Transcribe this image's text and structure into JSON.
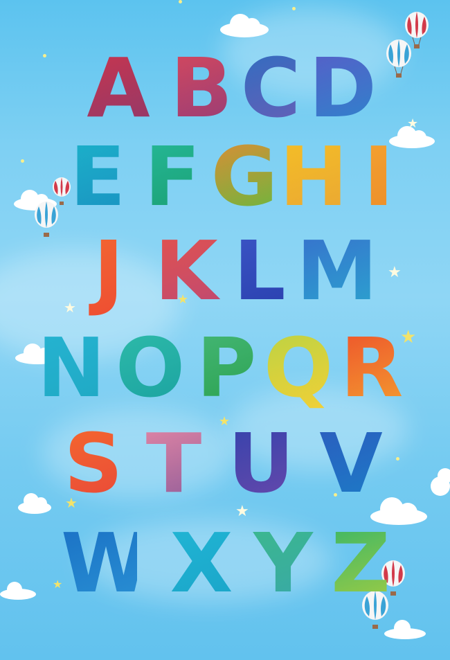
{
  "poster": {
    "background_color": "#7ed0f3",
    "decorations": [
      "cloud",
      "hot-air-balloon",
      "star"
    ]
  },
  "alphabet": [
    {
      "char": "A",
      "colors": [
        "#c8364c",
        "#8a3a6a"
      ]
    },
    {
      "char": "B",
      "colors": [
        "#d44a5c",
        "#8e3d78"
      ]
    },
    {
      "char": "C",
      "colors": [
        "#2f6fbd",
        "#6a5db2"
      ]
    },
    {
      "char": "D",
      "colors": [
        "#5a5cc2",
        "#2f86c9"
      ]
    },
    {
      "char": "E",
      "colors": [
        "#21b3c7",
        "#1f8fbe"
      ]
    },
    {
      "char": "F",
      "colors": [
        "#2bb89a",
        "#1f9b6f"
      ]
    },
    {
      "char": "G",
      "colors": [
        "#e28a3a",
        "#63b944"
      ]
    },
    {
      "char": "H",
      "colors": [
        "#f2c02d",
        "#e6a53a"
      ]
    },
    {
      "char": "I",
      "colors": [
        "#f0a437",
        "#e88d2e"
      ]
    },
    {
      "char": "J",
      "colors": [
        "#ec6a35",
        "#e84d35"
      ]
    },
    {
      "char": "K",
      "colors": [
        "#e0544c",
        "#b84a74"
      ]
    },
    {
      "char": "L",
      "colors": [
        "#3d56c2",
        "#2a3fa8"
      ]
    },
    {
      "char": "M",
      "colors": [
        "#3a6fc8",
        "#2fa3cc"
      ]
    },
    {
      "char": "N",
      "colors": [
        "#2bb3cf",
        "#24a7c0"
      ]
    },
    {
      "char": "O",
      "colors": [
        "#34bba8",
        "#1fa0a0"
      ]
    },
    {
      "char": "P",
      "colors": [
        "#4ab77a",
        "#2e9f4f"
      ]
    },
    {
      "char": "Q",
      "colors": [
        "#b8d24a",
        "#f2d03d"
      ]
    },
    {
      "char": "R",
      "colors": [
        "#e7502f",
        "#f0a035"
      ]
    },
    {
      "char": "S",
      "colors": [
        "#ef6b31",
        "#e2483c"
      ]
    },
    {
      "char": "T",
      "colors": [
        "#e48aa5",
        "#8a5b96"
      ]
    },
    {
      "char": "U",
      "colors": [
        "#3342a6",
        "#6a4aa8"
      ]
    },
    {
      "char": "V",
      "colors": [
        "#2f5cb8",
        "#1e7cc4"
      ]
    },
    {
      "char": "W",
      "colors": [
        "#1e6fc0",
        "#2d8fd0"
      ]
    },
    {
      "char": "X",
      "colors": [
        "#28b5d2",
        "#1ea3c5"
      ]
    },
    {
      "char": "Y",
      "colors": [
        "#40b88c",
        "#3ca6a8"
      ]
    },
    {
      "char": "Z",
      "colors": [
        "#3ab46a",
        "#a5cc48"
      ]
    }
  ]
}
